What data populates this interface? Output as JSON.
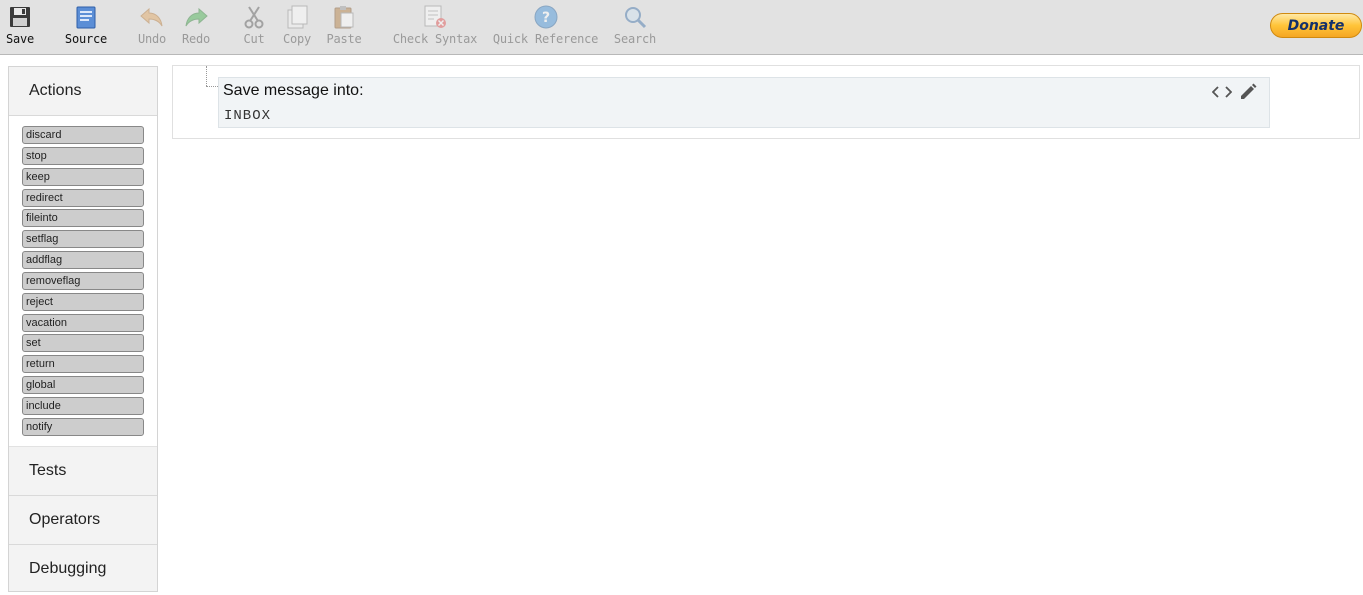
{
  "toolbar": {
    "buttons": [
      {
        "label": "Save",
        "icon": "save-icon",
        "enabled": true
      },
      {
        "label": "Source",
        "icon": "source-icon",
        "enabled": true
      },
      {
        "label": "Undo",
        "icon": "undo-icon",
        "enabled": false
      },
      {
        "label": "Redo",
        "icon": "redo-icon",
        "enabled": false
      },
      {
        "label": "Cut",
        "icon": "cut-icon",
        "enabled": false
      },
      {
        "label": "Copy",
        "icon": "copy-icon",
        "enabled": false
      },
      {
        "label": "Paste",
        "icon": "paste-icon",
        "enabled": false
      },
      {
        "label": "Check Syntax",
        "icon": "check-syntax-icon",
        "enabled": false
      },
      {
        "label": "Quick Reference",
        "icon": "help-icon",
        "enabled": false
      },
      {
        "label": "Search",
        "icon": "search-icon",
        "enabled": false
      }
    ],
    "donate_label": "Donate"
  },
  "sidebar": {
    "actions_title": "Actions",
    "actions": [
      "discard",
      "stop",
      "keep",
      "redirect",
      "fileinto",
      "setflag",
      "addflag",
      "removeflag",
      "reject",
      "vacation",
      "set",
      "return",
      "global",
      "include",
      "notify"
    ],
    "tests_title": "Tests",
    "operators_title": "Operators",
    "debugging_title": "Debugging"
  },
  "main": {
    "block": {
      "title": "Save message into:",
      "value": "INBOX"
    }
  },
  "colors": {
    "toolbar_bg": "#e2e2e2",
    "action_button_bg": "#cdcdcd",
    "block_bg": "#f1f4f6",
    "donate_accent": "#ffc439"
  }
}
